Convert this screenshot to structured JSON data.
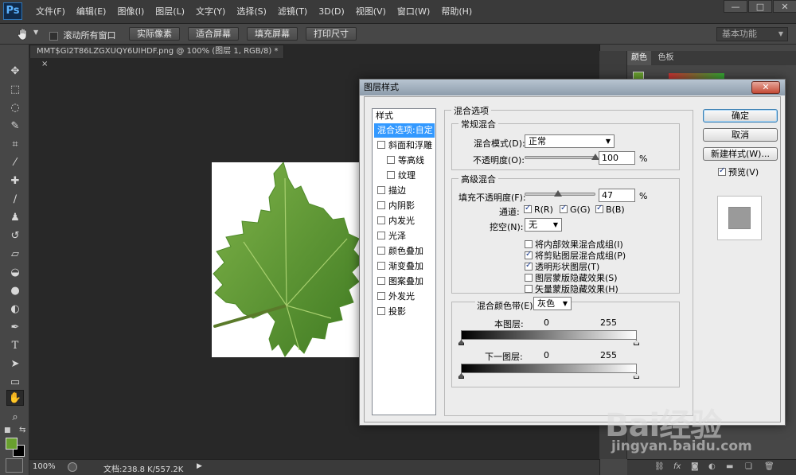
{
  "app": {
    "logo": "Ps"
  },
  "menu": [
    "文件(F)",
    "编辑(E)",
    "图像(I)",
    "图层(L)",
    "文字(Y)",
    "选择(S)",
    "滤镜(T)",
    "3D(D)",
    "视图(V)",
    "窗口(W)",
    "帮助(H)"
  ],
  "window_controls": [
    "—",
    "□",
    "✕"
  ],
  "options_bar": {
    "tool_icon": "hand-icon",
    "scroll_all": "滚动所有窗口",
    "scroll_all_checked": false,
    "buttons": [
      "实际像素",
      "适合屏幕",
      "填充屏幕",
      "打印尺寸"
    ],
    "workspace": "基本功能"
  },
  "document": {
    "tab_title": "MMT$GI2T86LZGXUQY6UIHDF.png @ 100% (图层 1, RGB/8) *",
    "tab_close": "×",
    "zoom": "100%",
    "doc_info": "文档:238.8 K/557.2K"
  },
  "colors": {
    "foreground": "#69a02f",
    "background": "#000000",
    "highlight": "#3399ff"
  },
  "panels": {
    "tabs": [
      "颜色",
      "色板"
    ]
  },
  "dialog": {
    "title": "图层样式",
    "close": "✕",
    "style_list": {
      "header": "样式",
      "items": [
        {
          "label": "混合选项:自定",
          "selected": true,
          "has_checkbox": false,
          "indent": false
        },
        {
          "label": "斜面和浮雕",
          "checked": false,
          "has_checkbox": true,
          "indent": false
        },
        {
          "label": "等高线",
          "checked": false,
          "has_checkbox": true,
          "indent": true
        },
        {
          "label": "纹理",
          "checked": false,
          "has_checkbox": true,
          "indent": true
        },
        {
          "label": "描边",
          "checked": false,
          "has_checkbox": true,
          "indent": false
        },
        {
          "label": "内阴影",
          "checked": false,
          "has_checkbox": true,
          "indent": false
        },
        {
          "label": "内发光",
          "checked": false,
          "has_checkbox": true,
          "indent": false
        },
        {
          "label": "光泽",
          "checked": false,
          "has_checkbox": true,
          "indent": false
        },
        {
          "label": "颜色叠加",
          "checked": false,
          "has_checkbox": true,
          "indent": false
        },
        {
          "label": "渐变叠加",
          "checked": false,
          "has_checkbox": true,
          "indent": false
        },
        {
          "label": "图案叠加",
          "checked": false,
          "has_checkbox": true,
          "indent": false
        },
        {
          "label": "外发光",
          "checked": false,
          "has_checkbox": true,
          "indent": false
        },
        {
          "label": "投影",
          "checked": false,
          "has_checkbox": true,
          "indent": false
        }
      ]
    },
    "blend_options": {
      "title": "混合选项",
      "general": {
        "title": "常规混合",
        "blend_mode_label": "混合模式(D):",
        "blend_mode_value": "正常",
        "opacity_label": "不透明度(O):",
        "opacity_value": "100",
        "opacity_fraction": 1.0,
        "unit": "%"
      },
      "advanced": {
        "title": "高级混合",
        "fill_opacity_label": "填充不透明度(F):",
        "fill_opacity_value": "47",
        "fill_opacity_fraction": 0.47,
        "unit": "%",
        "channels_label": "通道:",
        "channels": [
          {
            "label": "R(R)",
            "checked": true
          },
          {
            "label": "G(G)",
            "checked": true
          },
          {
            "label": "B(B)",
            "checked": true
          }
        ],
        "knockout_label": "挖空(N):",
        "knockout_value": "无",
        "options": [
          {
            "label": "将内部效果混合成组(I)",
            "checked": false
          },
          {
            "label": "将剪贴图层混合成组(P)",
            "checked": true
          },
          {
            "label": "透明形状图层(T)",
            "checked": true
          },
          {
            "label": "图层蒙版隐藏效果(S)",
            "checked": false
          },
          {
            "label": "矢量蒙版隐藏效果(H)",
            "checked": false
          }
        ]
      },
      "blend_if": {
        "label": "混合颜色带(E):",
        "value": "灰色",
        "this_layer_label": "本图层:",
        "this_layer_min": "0",
        "this_layer_max": "255",
        "underlying_label": "下一图层:",
        "underlying_min": "0",
        "underlying_max": "255"
      }
    },
    "buttons": {
      "ok": "确定",
      "cancel": "取消",
      "new_style": "新建样式(W)...",
      "preview_label": "预览(V)",
      "preview_checked": true
    }
  },
  "watermark": {
    "brand": "Bai经验",
    "url": "jingyan.baidu.com"
  }
}
